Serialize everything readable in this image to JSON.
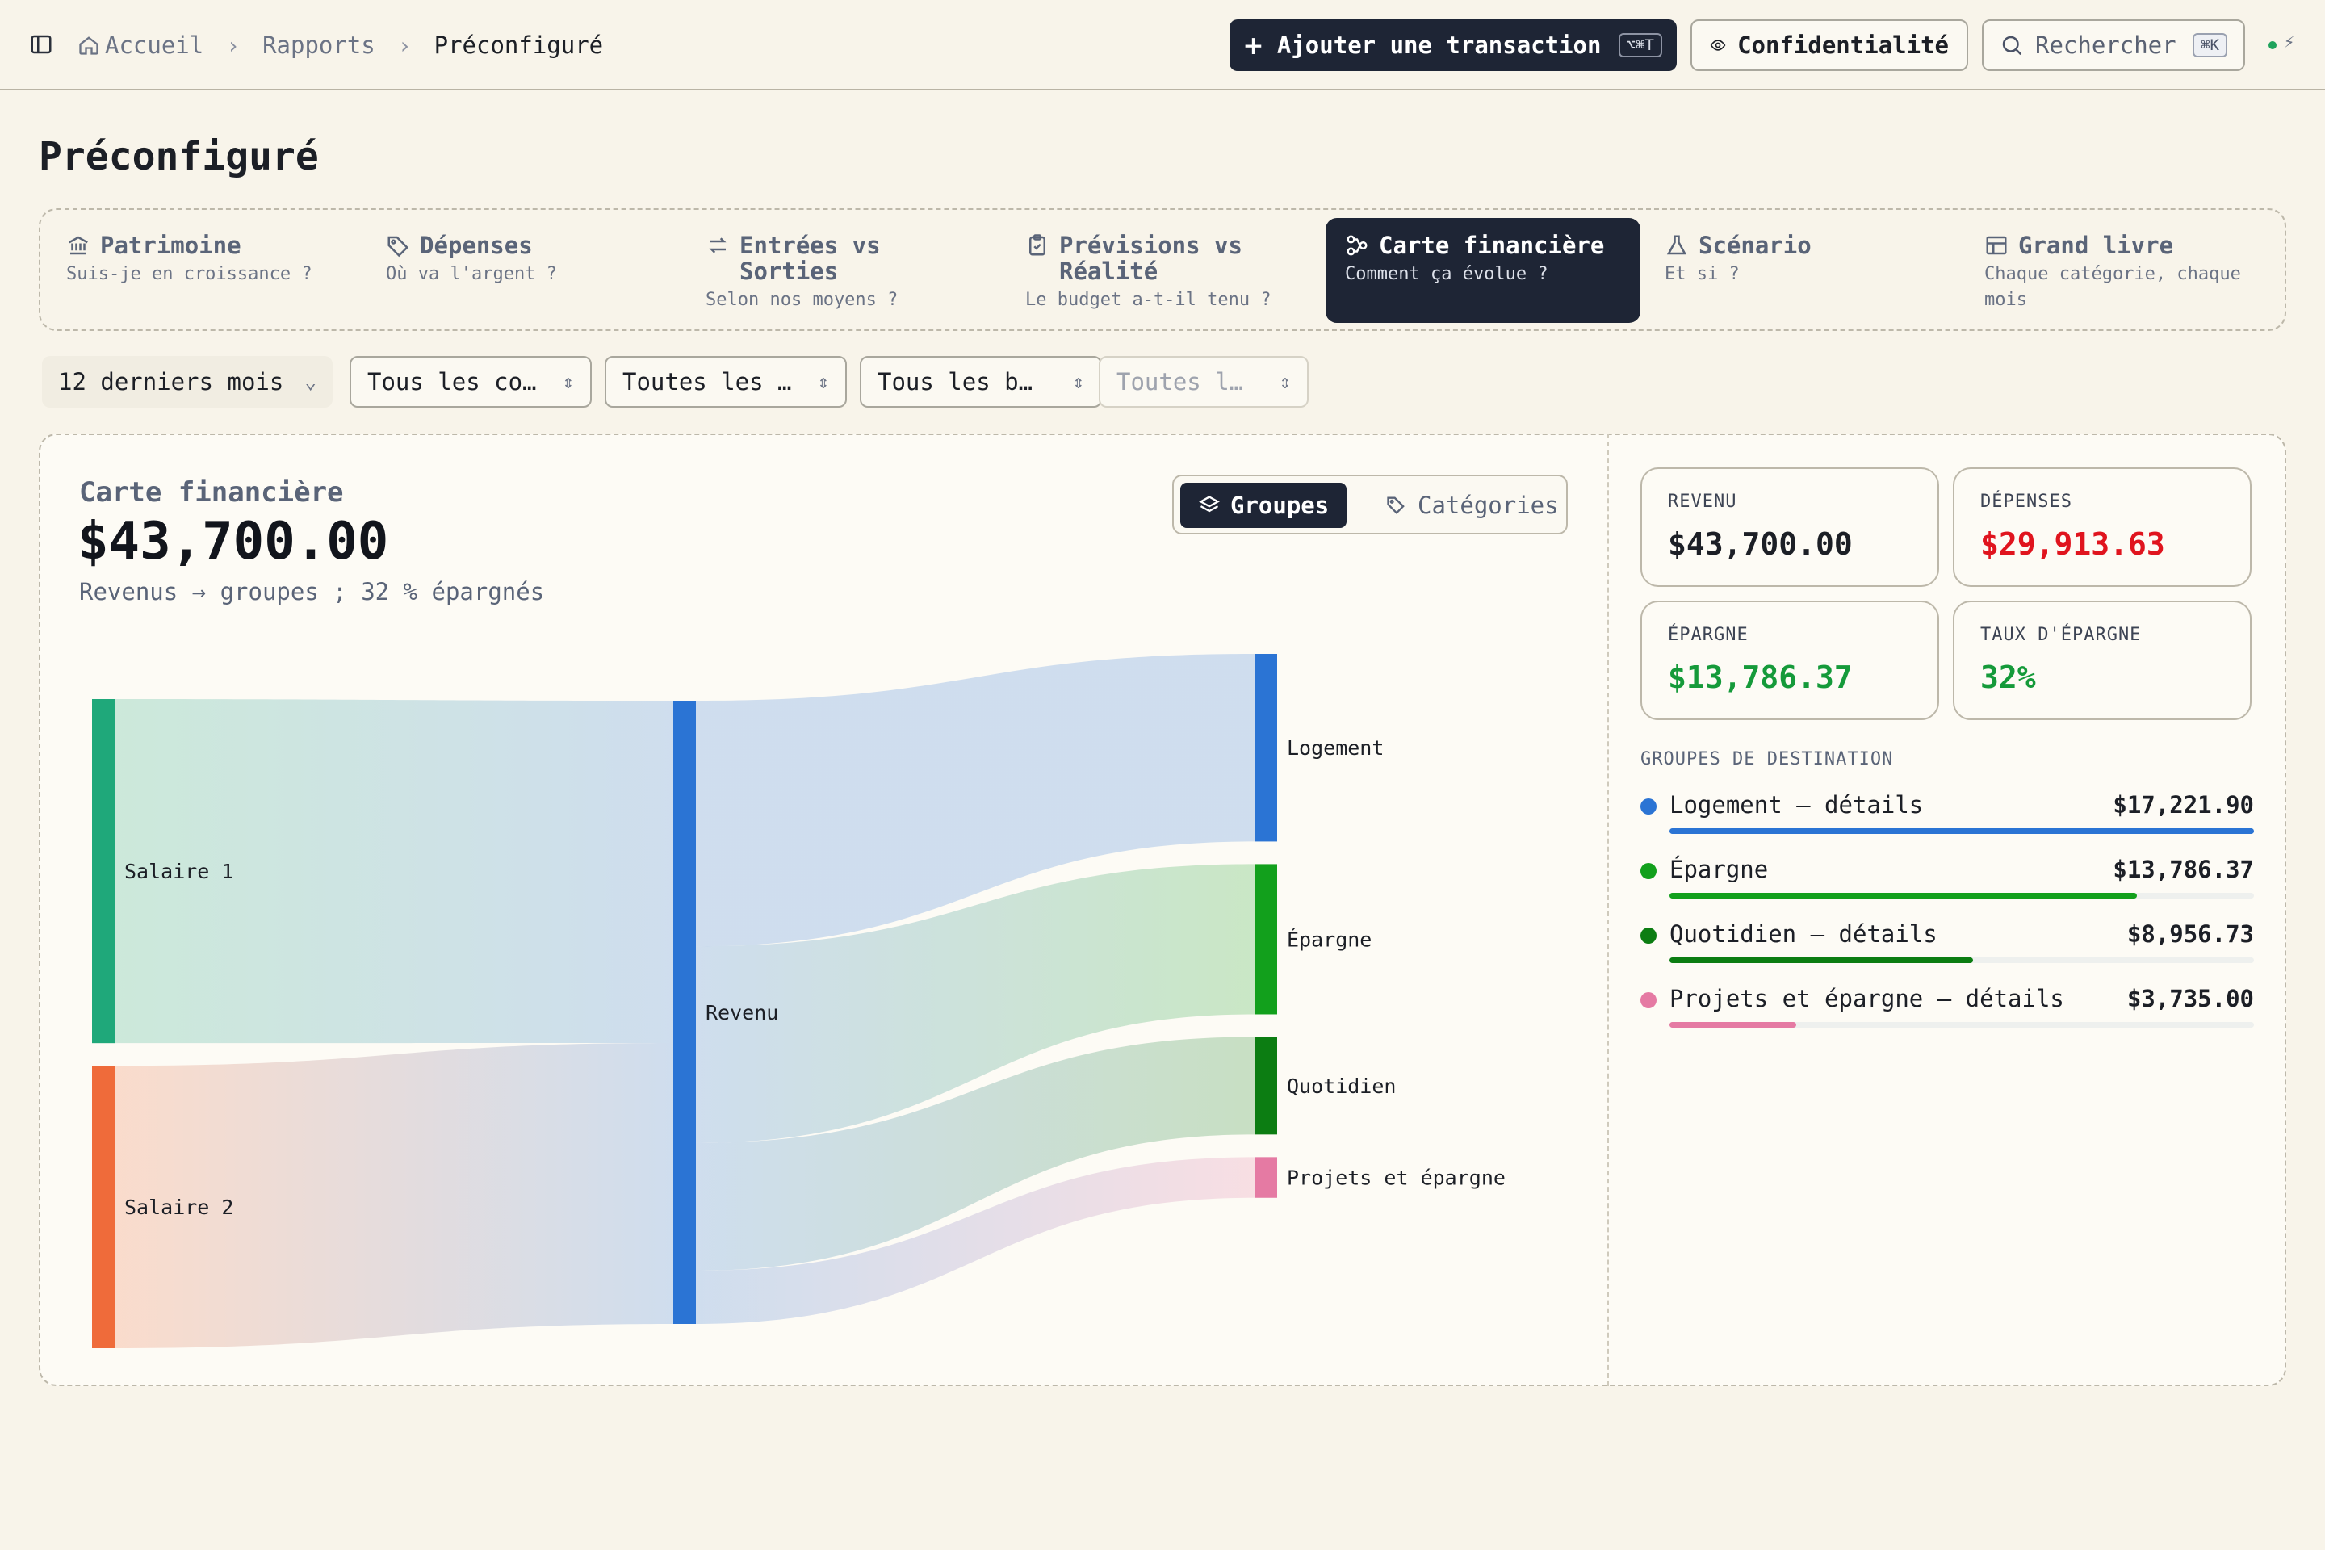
{
  "breadcrumb": {
    "home": "Accueil",
    "reports": "Rapports",
    "current": "Préconfiguré"
  },
  "header": {
    "add_label": "Ajouter une transaction",
    "add_shortcut": "⌥⌘T",
    "privacy_label": "Confidentialité",
    "search_label": "Rechercher",
    "search_shortcut": "⌘K"
  },
  "page_title": "Préconfiguré",
  "tabs": [
    {
      "title": "Patrimoine",
      "subtitle": "Suis-je en croissance ?",
      "icon": "bank-icon"
    },
    {
      "title": "Dépenses",
      "subtitle": "Où va l'argent ?",
      "icon": "tag-icon"
    },
    {
      "title": "Entrées vs Sorties",
      "subtitle": "Selon nos moyens ?",
      "icon": "arrows-icon"
    },
    {
      "title": "Prévisions vs Réalité",
      "subtitle": "Le budget a-t-il tenu ?",
      "icon": "clipboard-icon"
    },
    {
      "title": "Carte financière",
      "subtitle": "Comment ça évolue ?",
      "icon": "flow-icon",
      "active": true
    },
    {
      "title": "Scénario",
      "subtitle": "Et si ?",
      "icon": "flask-icon"
    },
    {
      "title": "Grand livre",
      "subtitle": "Chaque catégorie, chaque mois",
      "icon": "table-icon"
    }
  ],
  "filters": {
    "period": "12 derniers mois",
    "accounts": "Tous les co…",
    "categories": "Toutes les …",
    "budgets": "Tous les b…",
    "other": "Toutes l…"
  },
  "chart": {
    "label": "Carte financière",
    "total": "$43,700.00",
    "subtitle": "Revenus → groupes ; 32 % épargnés",
    "toggle_groups": "Groupes",
    "toggle_categories": "Catégories"
  },
  "chart_data": {
    "type": "sankey",
    "nodes": [
      {
        "id": "s1",
        "label": "Salaire 1",
        "color": "#1fa87a"
      },
      {
        "id": "s2",
        "label": "Salaire 2",
        "color": "#ef6b3a"
      },
      {
        "id": "rev",
        "label": "Revenu",
        "color": "#2b74d4"
      },
      {
        "id": "log",
        "label": "Logement",
        "color": "#2b74d4"
      },
      {
        "id": "epa",
        "label": "Épargne",
        "color": "#12a01c"
      },
      {
        "id": "quo",
        "label": "Quotidien",
        "color": "#0c7d12"
      },
      {
        "id": "pro",
        "label": "Projets et épargne",
        "color": "#e57aa3"
      }
    ],
    "links": [
      {
        "source": "s1",
        "target": "rev",
        "value": 24000
      },
      {
        "source": "s2",
        "target": "rev",
        "value": 19700
      },
      {
        "source": "rev",
        "target": "log",
        "value": 17221.9
      },
      {
        "source": "rev",
        "target": "epa",
        "value": 13786.37
      },
      {
        "source": "rev",
        "target": "quo",
        "value": 8956.73
      },
      {
        "source": "rev",
        "target": "pro",
        "value": 3735.0
      }
    ]
  },
  "kpis": {
    "revenue_label": "REVENU",
    "revenue_value": "$43,700.00",
    "expenses_label": "DÉPENSES",
    "expenses_value": "$29,913.63",
    "savings_label": "ÉPARGNE",
    "savings_value": "$13,786.37",
    "rate_label": "TAUX D'ÉPARGNE",
    "rate_value": "32%"
  },
  "colors": {
    "expense_red": "#e0141e",
    "saving_green": "#159a3a",
    "dark": "#1e2535"
  },
  "destinations": {
    "title": "GROUPES DE DESTINATION",
    "items": [
      {
        "name": "Logement — détails",
        "value": "$17,221.90",
        "color": "#2b74d4",
        "share": 1.0
      },
      {
        "name": "Épargne",
        "value": "$13,786.37",
        "color": "#12a01c",
        "share": 0.8
      },
      {
        "name": "Quotidien — détails",
        "value": "$8,956.73",
        "color": "#0c7d12",
        "share": 0.52
      },
      {
        "name": "Projets et épargne — détails",
        "value": "$3,735.00",
        "color": "#e57aa3",
        "share": 0.217
      }
    ]
  }
}
